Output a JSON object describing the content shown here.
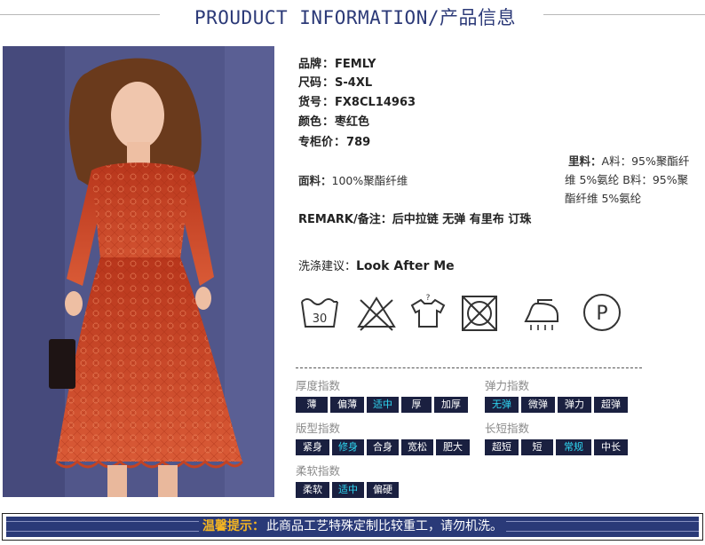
{
  "header": {
    "title": "PROUDUCT INFORMATION/产品信息"
  },
  "specs": {
    "brand_label": "品牌",
    "brand": "FEMLY",
    "size_label": "尺码",
    "size": "S-4XL",
    "sku_label": "货号",
    "sku": "FX8CL14963",
    "color_label": "颜色",
    "color": "枣红色",
    "price_label": "专柜价",
    "price": "789"
  },
  "lining": {
    "label": "里料：",
    "value": "A料：95%聚酯纤维 5%氨纶 B料：95%聚酯纤维 5%氨纶"
  },
  "fabric": {
    "label": "面料：",
    "value": "100%聚酯纤维"
  },
  "remark": {
    "label": "REMARK/备注：",
    "value": "后中拉链 无弹 有里布 订珠"
  },
  "washing": {
    "label": "洗涤建议：",
    "value": "Look After Me"
  },
  "care_icons": [
    {
      "name": "wash-30-icon",
      "text": "30"
    },
    {
      "name": "no-bleach-icon"
    },
    {
      "name": "no-wring-icon"
    },
    {
      "name": "no-tumble-dry-icon"
    },
    {
      "name": "iron-low-icon"
    },
    {
      "name": "dry-clean-p-icon",
      "text": "P"
    }
  ],
  "indices": {
    "thickness": {
      "label": "厚度指数",
      "options": [
        "薄",
        "偏薄",
        "适中",
        "厚",
        "加厚"
      ],
      "selected": "适中"
    },
    "elasticity": {
      "label": "弹力指数",
      "options": [
        "无弹",
        "微弹",
        "弹力",
        "超弹"
      ],
      "selected": "无弹"
    },
    "fit": {
      "label": "版型指数",
      "options": [
        "紧身",
        "修身",
        "合身",
        "宽松",
        "肥大"
      ],
      "selected": "修身"
    },
    "length": {
      "label": "长短指数",
      "options": [
        "超短",
        "短",
        "常规",
        "中长"
      ],
      "selected": "常规"
    },
    "softness": {
      "label": "柔软指数",
      "options": [
        "柔软",
        "适中",
        "偏硬"
      ],
      "selected": "适中"
    }
  },
  "notice": {
    "label": "温馨提示：",
    "text": "此商品工艺特殊定制比较重工，请勿机洗。"
  },
  "colors": {
    "title": "#2c3a78",
    "chip_bg": "#1a2040",
    "chip_active": "#2fd9f4",
    "notice_bg": "#2a3a78",
    "notice_label": "#f5b621"
  }
}
